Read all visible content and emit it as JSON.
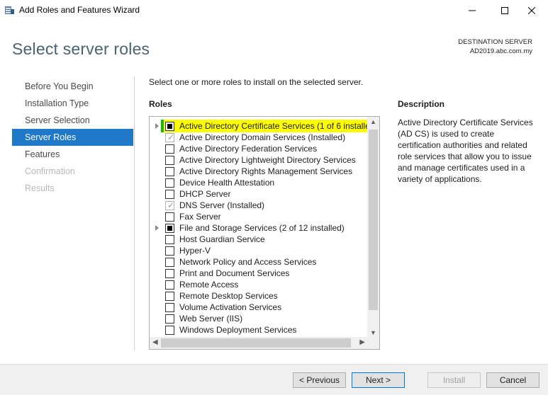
{
  "window": {
    "title": "Add Roles and Features Wizard",
    "minimize_icon": "minimize-icon",
    "maximize_icon": "maximize-icon",
    "close_icon": "close-icon"
  },
  "header": {
    "page_title": "Select server roles",
    "destination_label": "DESTINATION SERVER",
    "destination_value": "AD2019.abc.com.my"
  },
  "nav": {
    "items": [
      {
        "label": "Before You Begin",
        "state": "normal"
      },
      {
        "label": "Installation Type",
        "state": "normal"
      },
      {
        "label": "Server Selection",
        "state": "normal"
      },
      {
        "label": "Server Roles",
        "state": "active"
      },
      {
        "label": "Features",
        "state": "normal"
      },
      {
        "label": "Confirmation",
        "state": "disabled"
      },
      {
        "label": "Results",
        "state": "disabled"
      }
    ]
  },
  "main": {
    "instruction": "Select one or more roles to install on the selected server.",
    "roles_heading": "Roles",
    "description_heading": "Description",
    "description_text": "Active Directory Certificate Services (AD CS) is used to create certification authorities and related role services that allow you to issue and manage certificates used in a variety of applications.",
    "roles": [
      {
        "label": "Active Directory Certificate Services (1 of 6 installe",
        "check": "partial",
        "expandable": true,
        "highlight": true
      },
      {
        "label": "Active Directory Domain Services (Installed)",
        "check": "installed",
        "expandable": false
      },
      {
        "label": "Active Directory Federation Services",
        "check": "none",
        "expandable": false
      },
      {
        "label": "Active Directory Lightweight Directory Services",
        "check": "none",
        "expandable": false
      },
      {
        "label": "Active Directory Rights Management Services",
        "check": "none",
        "expandable": false
      },
      {
        "label": "Device Health Attestation",
        "check": "none",
        "expandable": false
      },
      {
        "label": "DHCP Server",
        "check": "none",
        "expandable": false
      },
      {
        "label": "DNS Server (Installed)",
        "check": "installed",
        "expandable": false
      },
      {
        "label": "Fax Server",
        "check": "none",
        "expandable": false
      },
      {
        "label": "File and Storage Services (2 of 12 installed)",
        "check": "partial",
        "expandable": true
      },
      {
        "label": "Host Guardian Service",
        "check": "none",
        "expandable": false
      },
      {
        "label": "Hyper-V",
        "check": "none",
        "expandable": false
      },
      {
        "label": "Network Policy and Access Services",
        "check": "none",
        "expandable": false
      },
      {
        "label": "Print and Document Services",
        "check": "none",
        "expandable": false
      },
      {
        "label": "Remote Access",
        "check": "none",
        "expandable": false
      },
      {
        "label": "Remote Desktop Services",
        "check": "none",
        "expandable": false
      },
      {
        "label": "Volume Activation Services",
        "check": "none",
        "expandable": false
      },
      {
        "label": "Web Server (IIS)",
        "check": "none",
        "expandable": false
      },
      {
        "label": "Windows Deployment Services",
        "check": "none",
        "expandable": false
      }
    ]
  },
  "footer": {
    "previous": "< Previous",
    "next": "Next >",
    "install": "Install",
    "cancel": "Cancel"
  },
  "colors": {
    "active_nav": "#1f78c8",
    "highlight_fill": "#fcfc02",
    "highlight_border": "#19b900",
    "title_color": "#4b6271"
  }
}
